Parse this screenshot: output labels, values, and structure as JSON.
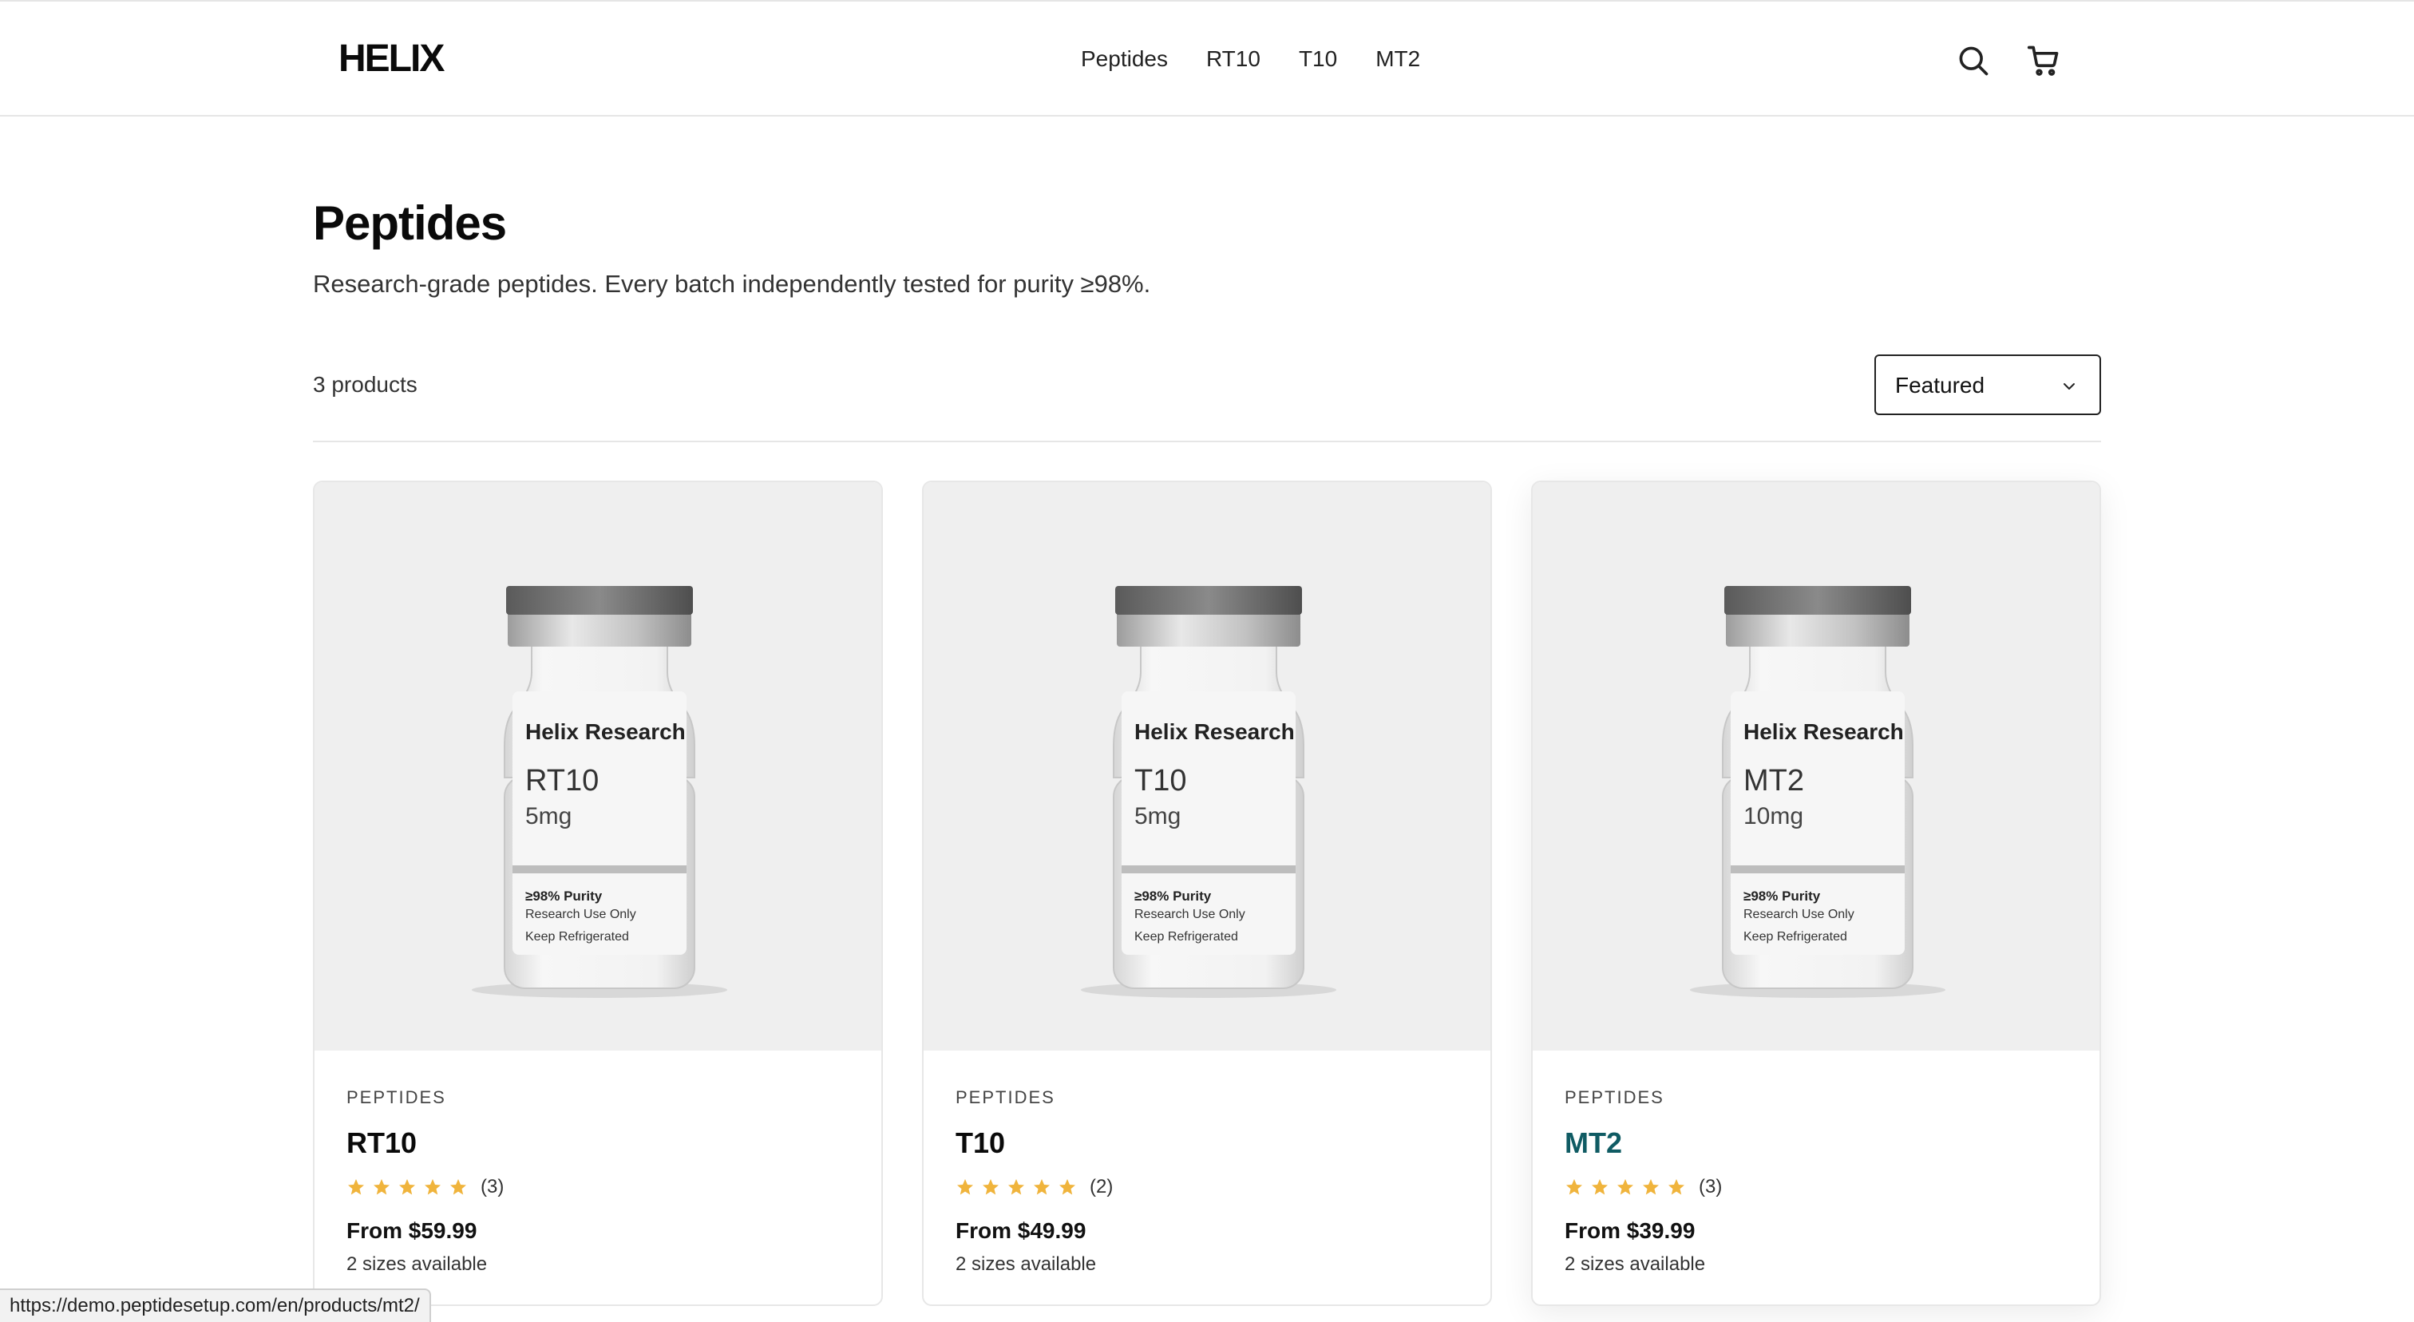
{
  "header": {
    "logo": "HELIX",
    "nav": [
      "Peptides",
      "RT10",
      "T10",
      "MT2"
    ],
    "icons": [
      "search-icon",
      "cart-icon"
    ]
  },
  "page": {
    "title": "Peptides",
    "description": "Research-grade peptides. Every batch independently tested for purity ≥98%.",
    "count": "3 products",
    "sort": {
      "selected": "Featured"
    }
  },
  "products": [
    {
      "category": "PEPTIDES",
      "name": "RT10",
      "stars": 5,
      "reviews": "(3)",
      "price": "From $59.99",
      "sizes": "2 sizes available",
      "vial": {
        "brand": "Helix Research",
        "name": "RT10",
        "dose": "5mg",
        "purity": "≥98% Purity",
        "use": "Research Use Only",
        "storage": "Keep Refrigerated"
      }
    },
    {
      "category": "PEPTIDES",
      "name": "T10",
      "stars": 5,
      "reviews": "(2)",
      "price": "From $49.99",
      "sizes": "2 sizes available",
      "vial": {
        "brand": "Helix Research",
        "name": "T10",
        "dose": "5mg",
        "purity": "≥98% Purity",
        "use": "Research Use Only",
        "storage": "Keep Refrigerated"
      }
    },
    {
      "category": "PEPTIDES",
      "name": "MT2",
      "stars": 5,
      "reviews": "(3)",
      "price": "From $39.99",
      "sizes": "2 sizes available",
      "vial": {
        "brand": "Helix Research",
        "name": "MT2",
        "dose": "10mg",
        "purity": "≥98% Purity",
        "use": "Research Use Only",
        "storage": "Keep Refrigerated"
      }
    }
  ],
  "colors": {
    "accent_link": "#0f5b63",
    "star": "#f0b43c",
    "image_bg": "#efefef"
  },
  "statusbar": {
    "url": "https://demo.peptidesetup.com/en/products/mt2/"
  }
}
